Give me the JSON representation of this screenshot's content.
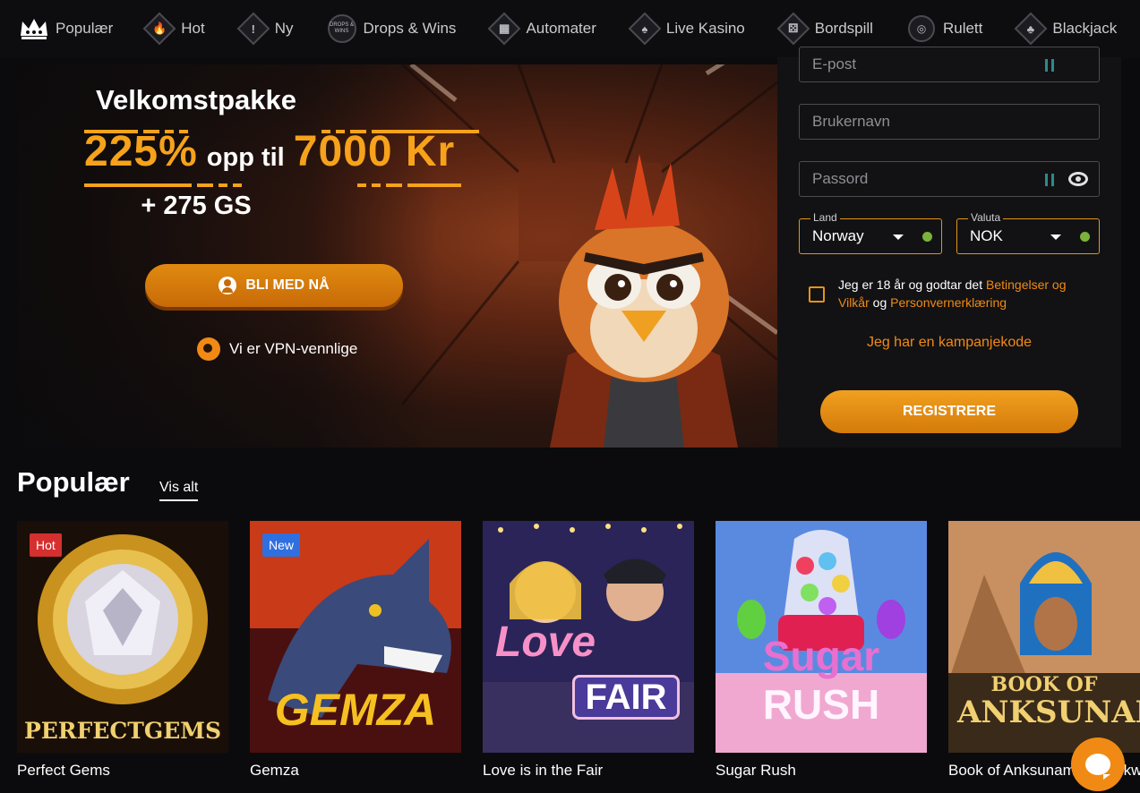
{
  "nav": {
    "items": [
      {
        "label": "Populær",
        "icon": "crown-icon"
      },
      {
        "label": "Hot",
        "icon": "flame-icon"
      },
      {
        "label": "Ny",
        "icon": "exclamation-icon"
      },
      {
        "label": "Drops & Wins",
        "icon": "drops-wins-icon"
      },
      {
        "label": "Automater",
        "icon": "slot-machine-icon"
      },
      {
        "label": "Live Kasino",
        "icon": "cards-icon"
      },
      {
        "label": "Bordspill",
        "icon": "dice-icon"
      },
      {
        "label": "Rulett",
        "icon": "roulette-icon"
      },
      {
        "label": "Blackjack",
        "icon": "blackjack-icon"
      }
    ],
    "drops_icon_text": "DROPS & WINS"
  },
  "hero": {
    "title": "Velkomstpakke",
    "bonus_percent": "225%",
    "bonus_mid": "opp til",
    "bonus_amount": "7000 Kr",
    "free_spins": "+ 275 GS",
    "join_label": "BLI MED NÅ",
    "vpn_text": "Vi er VPN-vennlige"
  },
  "register": {
    "email_placeholder": "E-post",
    "username_placeholder": "Brukernavn",
    "password_placeholder": "Passord",
    "country_label": "Land",
    "country_value": "Norway",
    "currency_label": "Valuta",
    "currency_value": "NOK",
    "terms_prefix": "Jeg er 18 år og godtar det",
    "terms_link": "Betingelser og Vilkår",
    "terms_and": "og",
    "privacy_link": "Personvernerklæring",
    "promo_link": "Jeg har en kampanjekode",
    "submit_label": "REGISTRERE"
  },
  "popular": {
    "title": "Populær",
    "view_all": "Vis alt",
    "games": [
      {
        "name": "Perfect Gems",
        "badge": "Hot",
        "badge_color": "#d62f2f",
        "logo": "PERFECTGEMS"
      },
      {
        "name": "Gemza",
        "badge": "New",
        "badge_color": "#2f6fe0",
        "logo": "GEMZA"
      },
      {
        "name": "Love is in the Fair",
        "badge": "",
        "badge_color": "",
        "logo": "Love"
      },
      {
        "name": "Sugar Rush",
        "badge": "",
        "badge_color": "",
        "logo": "Sugar"
      },
      {
        "name": "Book of Anksunamun Rockways",
        "badge": "",
        "badge_color": "",
        "logo": "BOOK OF"
      }
    ]
  },
  "colors": {
    "accent": "#f08a14",
    "bonus": "#f6a21b",
    "background": "#0b0b0d"
  }
}
